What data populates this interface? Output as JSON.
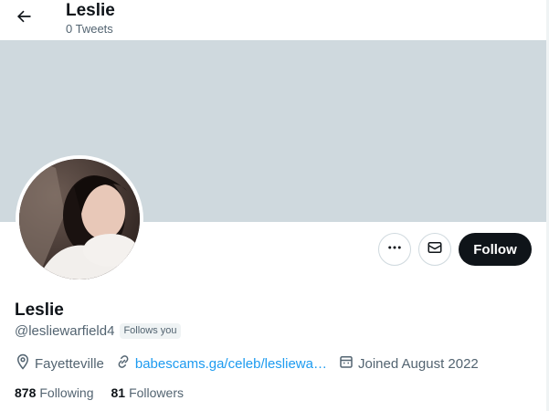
{
  "header": {
    "title": "Leslie",
    "subtitle": "0 Tweets",
    "back_icon": "arrow-left-icon"
  },
  "banner": {
    "color": "#cfd9de"
  },
  "actions": {
    "more_icon": "more-horizontal-icon",
    "message_icon": "envelope-icon",
    "follow_label": "Follow"
  },
  "profile": {
    "display_name": "Leslie",
    "handle": "@lesliewarfield4",
    "follows_you": "Follows you",
    "location": "Fayetteville",
    "link": "babescams.ga/celeb/lesliewa…",
    "joined": "Joined August 2022"
  },
  "stats": {
    "following_count": "878",
    "following_label": "Following",
    "followers_count": "81",
    "followers_label": "Followers"
  },
  "colors": {
    "accent": "#1d9bf0",
    "text_primary": "#0f1419",
    "text_secondary": "#536471",
    "follow_button": "#0f1419"
  }
}
